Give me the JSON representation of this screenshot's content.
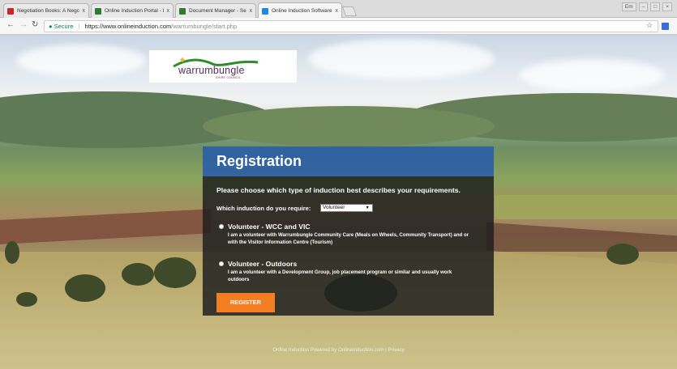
{
  "browser": {
    "tabs": [
      {
        "title": "Negotiation Books: A Negc",
        "favicon_color": "#c62828"
      },
      {
        "title": "Online Induction Portal - Il",
        "favicon_color": "#2e7d32"
      },
      {
        "title": "Document Manager - Sear",
        "favicon_color": "#2e7d32"
      },
      {
        "title": "Online Induction Software",
        "favicon_color": "#1e88e5"
      }
    ],
    "tab_close_glyph": "x",
    "window_user": "Em",
    "address": {
      "secure_label": "Secure",
      "url_domain": "https://www.onlineinduction.com",
      "url_path": "/warrumbungle/start.php"
    }
  },
  "logo": {
    "name": "warrumbungle",
    "subtitle": "SHIRE COUNCIL"
  },
  "registration": {
    "title": "Registration",
    "prompt": "Please choose which type of induction best describes your requirements.",
    "select_label": "Which induction do you require:",
    "select_value": "Volunteer",
    "options": [
      {
        "title": "Volunteer - WCC and VIC",
        "description": "I am a volunteer with Warrumbungle Community Care (Meals on Wheels, Community Transport) and or with the Visitor Information Centre (Tourism)"
      },
      {
        "title": "Volunteer - Outdoors",
        "description": "I am a volunteer with a Development Group, job placement program or similar and usually work outdoors"
      }
    ],
    "register_label": "REGISTER",
    "colors": {
      "header": "#285caa",
      "button": "#f47f22"
    }
  },
  "footer": {
    "text": "Online Induction Powered by OnlineInduction.com",
    "divider": "|",
    "privacy": "Privacy"
  }
}
